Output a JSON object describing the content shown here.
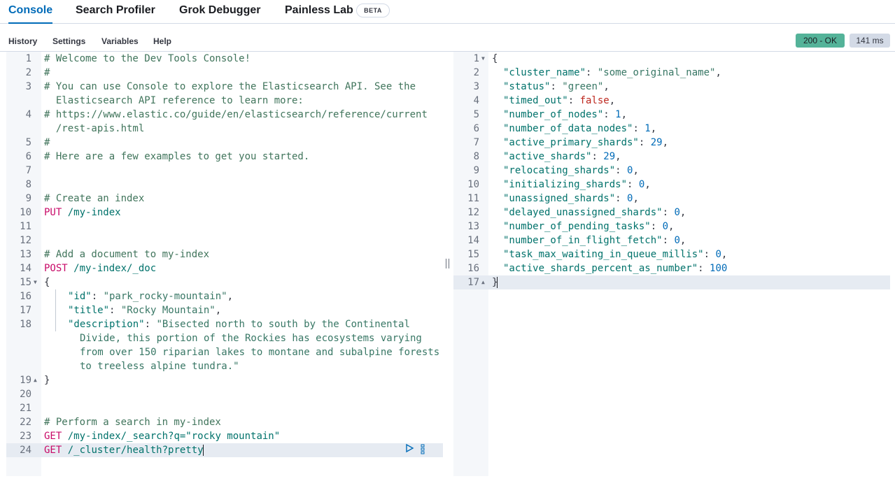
{
  "tabs": [
    {
      "label": "Console"
    },
    {
      "label": "Search Profiler"
    },
    {
      "label": "Grok Debugger"
    },
    {
      "label": "Painless Lab"
    }
  ],
  "beta_badge": "BETA",
  "menu": [
    "History",
    "Settings",
    "Variables",
    "Help"
  ],
  "status": {
    "code": "200 - OK",
    "time": "141 ms"
  },
  "request_editor": {
    "line_numbers": [
      "1",
      "2",
      "3",
      "4",
      "5",
      "6",
      "7",
      "8",
      "9",
      "10",
      "11",
      "12",
      "13",
      "14",
      "15",
      "16",
      "17",
      "18",
      "19",
      "20",
      "21",
      "22",
      "23",
      "24"
    ],
    "comments": {
      "l1": "# Welcome to the Dev Tools Console!",
      "l2": "#",
      "l3a": "# You can use Console to explore the Elasticsearch API. See the",
      "l3b": "  Elasticsearch API reference to learn more:",
      "l4a": "# https://www.elastic.co/guide/en/elasticsearch/reference/current",
      "l4b": "  /rest-apis.html",
      "l5": "#",
      "l6": "# Here are a few examples to get you started.",
      "l9": "# Create an index",
      "l13": "# Add a document to my-index",
      "l22": "# Perform a search in my-index"
    },
    "requests": {
      "put_method": "PUT",
      "put_url": " /my-index",
      "post_method": "POST",
      "post_url": " /my-index/_doc",
      "get1_method": "GET",
      "get1_url": " /my-index/_search?q=\"rocky mountain\"",
      "get2_method": "GET",
      "get2_url": " /_cluster/health?pretty"
    },
    "body": {
      "open": "{",
      "close": "}",
      "id_key": "\"id\"",
      "id_val": "\"park_rocky-mountain\"",
      "title_key": "\"title\"",
      "title_val": "\"Rocky Mountain\"",
      "desc_key": "\"description\"",
      "desc_val1": "\"Bisected north to south by the Continental",
      "desc_val2": "Divide, this portion of the Rockies has ecosystems varying",
      "desc_val3": "from over 150 riparian lakes to montane and subalpine forests",
      "desc_val4": "to treeless alpine tundra.\""
    }
  },
  "response_editor": {
    "line_numbers": [
      "1",
      "2",
      "3",
      "4",
      "5",
      "6",
      "7",
      "8",
      "9",
      "10",
      "11",
      "12",
      "13",
      "14",
      "15",
      "16",
      "17"
    ],
    "open": "{",
    "close": "}",
    "fields": [
      {
        "key": "\"cluster_name\"",
        "value": "\"some_original_name\"",
        "type": "str",
        "comma": ","
      },
      {
        "key": "\"status\"",
        "value": "\"green\"",
        "type": "str",
        "comma": ","
      },
      {
        "key": "\"timed_out\"",
        "value": "false",
        "type": "bool",
        "comma": ","
      },
      {
        "key": "\"number_of_nodes\"",
        "value": "1",
        "type": "num",
        "comma": ","
      },
      {
        "key": "\"number_of_data_nodes\"",
        "value": "1",
        "type": "num",
        "comma": ","
      },
      {
        "key": "\"active_primary_shards\"",
        "value": "29",
        "type": "num",
        "comma": ","
      },
      {
        "key": "\"active_shards\"",
        "value": "29",
        "type": "num",
        "comma": ","
      },
      {
        "key": "\"relocating_shards\"",
        "value": "0",
        "type": "num",
        "comma": ","
      },
      {
        "key": "\"initializing_shards\"",
        "value": "0",
        "type": "num",
        "comma": ","
      },
      {
        "key": "\"unassigned_shards\"",
        "value": "0",
        "type": "num",
        "comma": ","
      },
      {
        "key": "\"delayed_unassigned_shards\"",
        "value": "0",
        "type": "num",
        "comma": ","
      },
      {
        "key": "\"number_of_pending_tasks\"",
        "value": "0",
        "type": "num",
        "comma": ","
      },
      {
        "key": "\"number_of_in_flight_fetch\"",
        "value": "0",
        "type": "num",
        "comma": ","
      },
      {
        "key": "\"task_max_waiting_in_queue_millis\"",
        "value": "0",
        "type": "num",
        "comma": ","
      },
      {
        "key": "\"active_shards_percent_as_number\"",
        "value": "100",
        "type": "num",
        "comma": ""
      }
    ]
  },
  "icons": {
    "play": "play-icon",
    "more": "more-vertical-icon",
    "fold": "fold-arrow-icon"
  }
}
